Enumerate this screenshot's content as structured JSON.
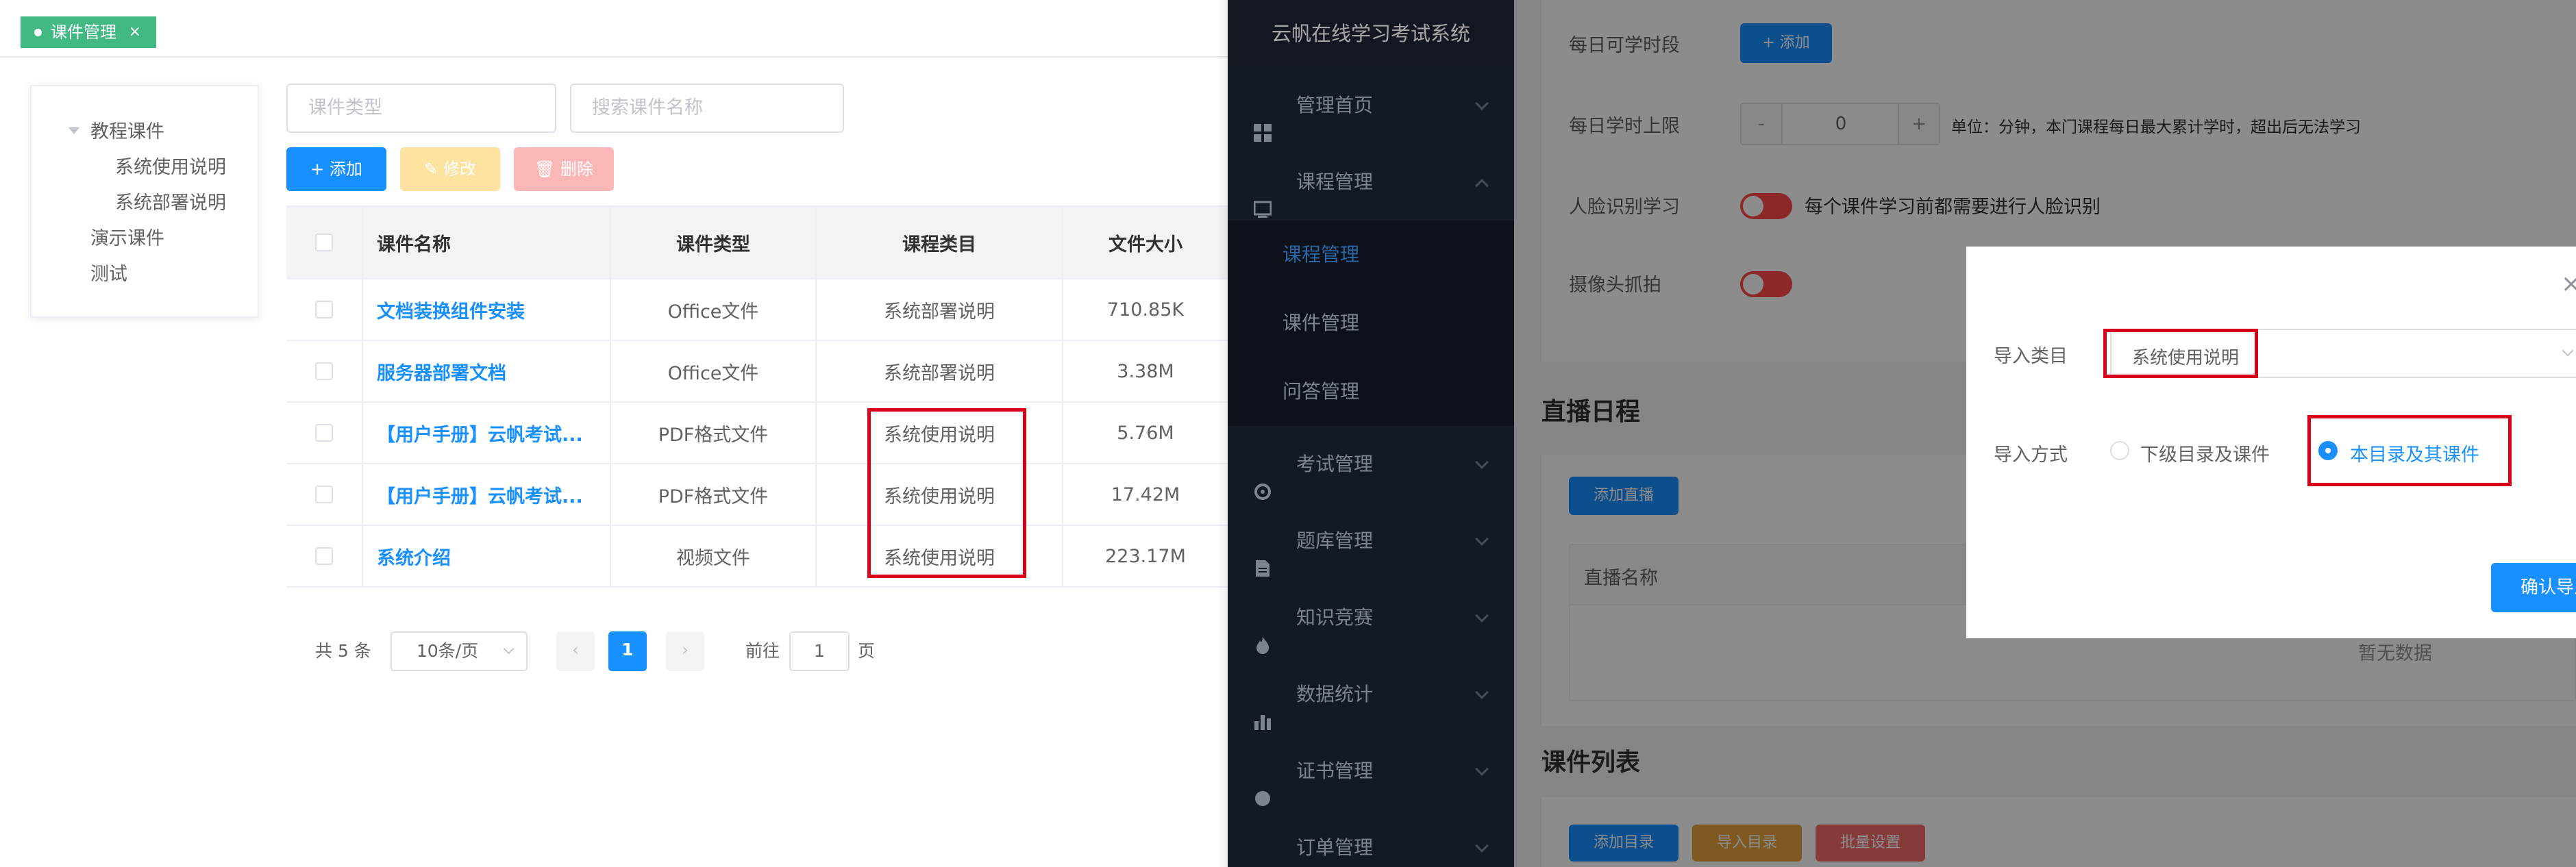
{
  "tab": {
    "label": "课件管理",
    "close": "×"
  },
  "tree": {
    "root": "教程课件",
    "children": [
      "系统使用说明",
      "系统部署说明"
    ],
    "siblings": [
      "演示课件",
      "测试"
    ]
  },
  "filters": {
    "type_placeholder": "课件类型",
    "search_placeholder": "搜索课件名称"
  },
  "toolbar": {
    "add": "+ 添加",
    "edit": "✎ 修改",
    "delete": "🗑 删除"
  },
  "table": {
    "headers": [
      "课件名称",
      "课件类型",
      "课程类目",
      "文件大小"
    ],
    "rows": [
      {
        "name": "文档装换组件安装",
        "type": "Office文件",
        "category": "系统部署说明",
        "size": "710.85K"
      },
      {
        "name": "服务器部署文档",
        "type": "Office文件",
        "category": "系统部署说明",
        "size": "3.38M"
      },
      {
        "name": "【用户手册】云帆考试...",
        "type": "PDF格式文件",
        "category": "系统使用说明",
        "size": "5.76M"
      },
      {
        "name": "【用户手册】云帆考试...",
        "type": "PDF格式文件",
        "category": "系统使用说明",
        "size": "17.42M"
      },
      {
        "name": "系统介绍",
        "type": "视频文件",
        "category": "系统使用说明",
        "size": "223.17M"
      }
    ]
  },
  "pagination": {
    "total": "共 5 条",
    "page_size": "10条/页",
    "prev": "‹",
    "current": "1",
    "next": "›",
    "goto_prefix": "前往",
    "goto_value": "1",
    "goto_suffix": "页"
  },
  "sidebar": {
    "title": "云帆在线学习考试系统",
    "items": [
      {
        "label": "管理首页",
        "icon": "dashboard-icon"
      },
      {
        "label": "课程管理",
        "icon": "book-icon",
        "expanded": true
      },
      {
        "label": "考试管理",
        "icon": "exam-icon"
      },
      {
        "label": "题库管理",
        "icon": "question-bank-icon"
      },
      {
        "label": "知识竞赛",
        "icon": "fire-icon"
      },
      {
        "label": "数据统计",
        "icon": "bar-chart-icon"
      },
      {
        "label": "证书管理",
        "icon": "certificate-icon"
      },
      {
        "label": "订单管理",
        "icon": "list-icon"
      }
    ],
    "sub_items": [
      "课程管理",
      "课件管理",
      "问答管理"
    ]
  },
  "settings": {
    "daily_period_label": "每日可学时段",
    "daily_period_add": "+ 添加",
    "daily_limit_label": "每日学时上限",
    "daily_limit_minus": "-",
    "daily_limit_value": "0",
    "daily_limit_plus": "+",
    "daily_limit_hint": "单位：分钟，本门课程每日最大累计学时，超出后无法学习",
    "face_label": "人脸识别学习",
    "face_hint": "每个课件学习前都需要进行人脸识别",
    "camera_label": "摄像头抓拍"
  },
  "live": {
    "title": "直播日程",
    "add": "添加直播",
    "col_name": "直播名称",
    "empty": "暂无数据"
  },
  "courseware_list": {
    "title": "课件列表",
    "add_dir": "添加目录",
    "import_dir": "导入目录",
    "batch": "批量设置"
  },
  "dialog": {
    "close": "×",
    "category_label": "导入类目",
    "category_value": "系统使用说明",
    "mode_label": "导入方式",
    "option_sub": "下级目录及课件",
    "option_self": "本目录及其课件",
    "confirm": "确认导入"
  },
  "colors": {
    "primary": "#1890ff",
    "tag_green": "#42b983",
    "highlight_red": "#d9001b",
    "sidebar_bg": "#20293a"
  }
}
